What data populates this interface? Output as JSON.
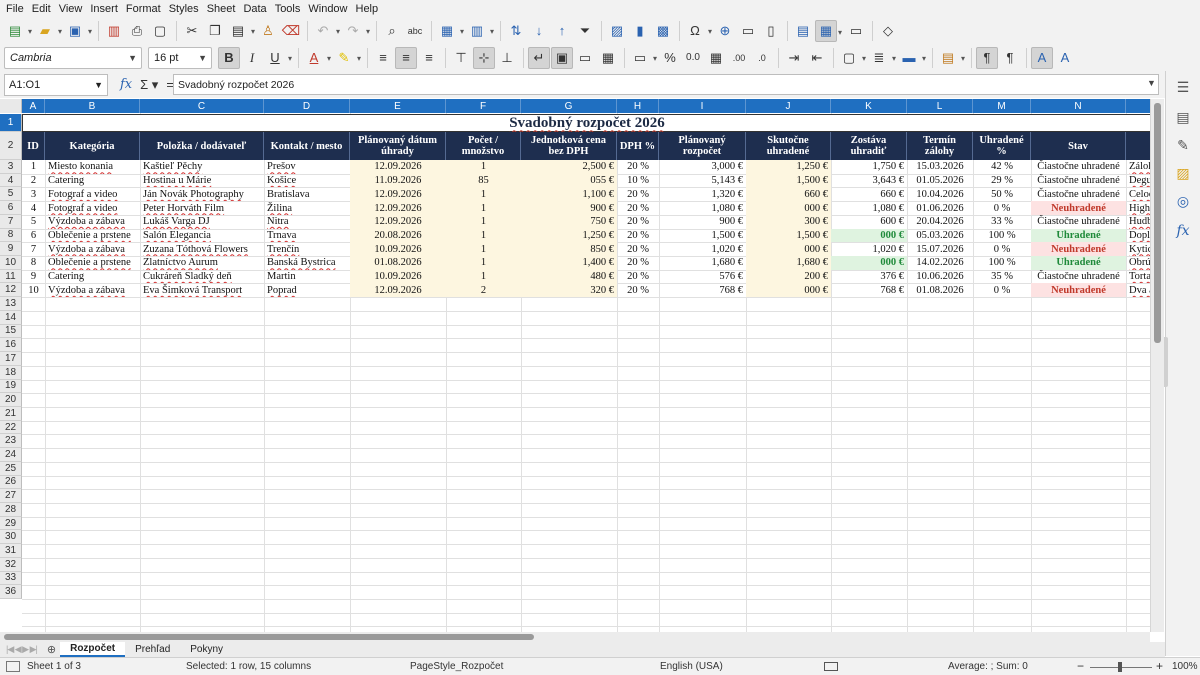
{
  "menu": [
    "File",
    "Edit",
    "View",
    "Insert",
    "Format",
    "Styles",
    "Sheet",
    "Data",
    "Tools",
    "Window",
    "Help"
  ],
  "font": {
    "name": "Cambria",
    "size": "16 pt"
  },
  "namebox": "A1:O1",
  "formula": "Svadobný rozpočet 2026",
  "columns": [
    "A",
    "B",
    "C",
    "D",
    "E",
    "F",
    "G",
    "H",
    "I",
    "J",
    "K",
    "L",
    "M",
    "N"
  ],
  "title": "Svadobný rozpočet 2026",
  "headers": [
    "ID",
    "Kategória",
    "Položka / dodávateľ",
    "Kontakt / mesto",
    "Plánovaný dátum úhrady",
    "Počet / množstvo",
    "Jednotková cena bez DPH",
    "DPH %",
    "Plánovaný rozpočet",
    "Skutočne uhradené",
    "Zostáva uhradiť",
    "Termín zálohy",
    "Uhradené %",
    "Stav",
    ""
  ],
  "rows": [
    [
      "1",
      "Miesto konania",
      "Kaštieľ Pěchy",
      "Prešov",
      "12.09.2026",
      "1",
      "2,500 €",
      "20 %",
      "3,000 €",
      "1,250 €",
      "1,750 €",
      "15.03.2026",
      "42 %",
      "Čiastočne uhradené",
      "Záloha"
    ],
    [
      "2",
      "Catering",
      "Hostina u Márie",
      "Košice",
      "11.09.2026",
      "85",
      "055 €",
      "10 %",
      "5,143 €",
      "1,500 €",
      "3,643 €",
      "01.05.2026",
      "29 %",
      "Čiastočne uhradené",
      "Degus"
    ],
    [
      "3",
      "Fotograf a video",
      "Ján Novák Photography",
      "Bratislava",
      "12.09.2026",
      "1",
      "1,100 €",
      "20 %",
      "1,320 €",
      "660 €",
      "660 €",
      "10.04.2026",
      "50 %",
      "Čiastočne uhradené",
      "Celod"
    ],
    [
      "4",
      "Fotograf a video",
      "Peter Horváth Film",
      "Žilina",
      "12.09.2026",
      "1",
      "900 €",
      "20 %",
      "1,080 €",
      "000 €",
      "1,080 €",
      "01.06.2026",
      "0 %",
      "Neuhradené",
      "Highli"
    ],
    [
      "5",
      "Výzdoba a zábava",
      "Lukáš Varga DJ",
      "Nitra",
      "12.09.2026",
      "1",
      "750 €",
      "20 %",
      "900 €",
      "300 €",
      "600 €",
      "20.04.2026",
      "33 %",
      "Čiastočne uhradené",
      "Hudba"
    ],
    [
      "6",
      "Oblečenie a prstene",
      "Salón Elegancia",
      "Trnava",
      "20.08.2026",
      "1",
      "1,250 €",
      "20 %",
      "1,500 €",
      "1,500 €",
      "000 €",
      "05.03.2026",
      "100 %",
      "Uhradené",
      "Dopla"
    ],
    [
      "7",
      "Výzdoba a zábava",
      "Zuzana Tóthová Flowers",
      "Trenčín",
      "10.09.2026",
      "1",
      "850 €",
      "20 %",
      "1,020 €",
      "000 €",
      "1,020 €",
      "15.07.2026",
      "0 %",
      "Neuhradené",
      "Kytice"
    ],
    [
      "8",
      "Oblečenie a prstene",
      "Zlatníctvo Aurum",
      "Banská Bystrica",
      "01.08.2026",
      "1",
      "1,400 €",
      "20 %",
      "1,680 €",
      "1,680 €",
      "000 €",
      "14.02.2026",
      "100 %",
      "Uhradené",
      "Obrúč"
    ],
    [
      "9",
      "Catering",
      "Cukráreň Sladký deň",
      "Martin",
      "10.09.2026",
      "1",
      "480 €",
      "20 %",
      "576 €",
      "200 €",
      "376 €",
      "10.06.2026",
      "35 %",
      "Čiastočne uhradené",
      "Torta"
    ],
    [
      "10",
      "Výzdoba a zábava",
      "Eva Šimková Transport",
      "Poprad",
      "12.09.2026",
      "2",
      "320 €",
      "20 %",
      "768 €",
      "000 €",
      "768 €",
      "01.08.2026",
      "0 %",
      "Neuhradené",
      "Dva au"
    ]
  ],
  "row_numbers": [
    "1",
    "2",
    "3",
    "4",
    "5",
    "6",
    "7",
    "8",
    "9",
    "10",
    "11",
    "12",
    "13",
    "14",
    "15",
    "16",
    "17",
    "18",
    "19",
    "20",
    "21",
    "22",
    "23",
    "24",
    "25",
    "26",
    "27",
    "28",
    "29",
    "30",
    "31",
    "32",
    "33",
    "36"
  ],
  "tabs": [
    "Rozpočet",
    "Prehľad",
    "Pokyny"
  ],
  "status": {
    "sheet": "Sheet 1 of 3",
    "selection": "Selected: 1 row, 15 columns",
    "pagestyle": "PageStyle_Rozpočet",
    "language": "English (USA)",
    "summary": "Average: ; Sum: 0",
    "zoom": "100%"
  }
}
